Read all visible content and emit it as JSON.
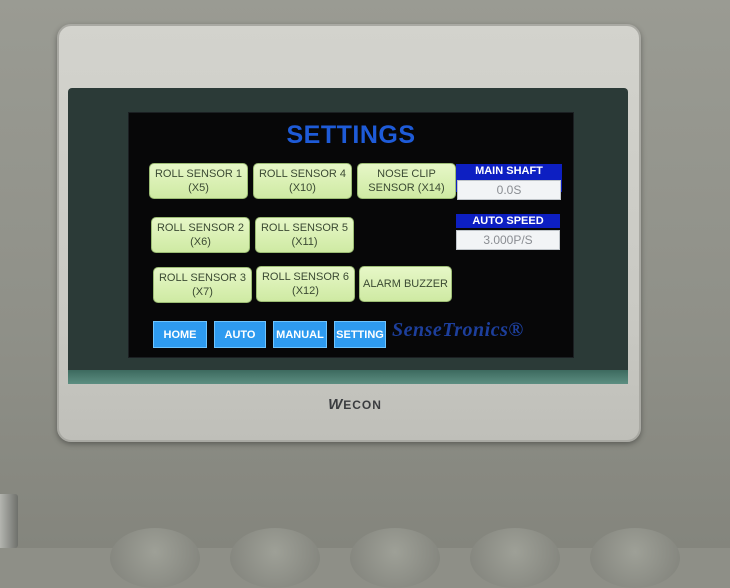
{
  "hmi": {
    "title": "SETTINGS",
    "sensor_buttons": [
      {
        "label": "ROLL SENSOR 1\n(X5)"
      },
      {
        "label": "ROLL SENSOR 4\n(X10)"
      },
      {
        "label": "NOSE CLIP\nSENSOR (X14)"
      },
      {
        "label": "ROLL SENSOR 2\n(X6)"
      },
      {
        "label": "ROLL SENSOR 5\n(X11)"
      },
      {
        "label": "ROLL SENSOR 3\n(X7)"
      },
      {
        "label": "ROLL SENSOR 6\n(X12)"
      },
      {
        "label": "ALARM BUZZER"
      }
    ],
    "main_shaft_delay": {
      "label": "MAIN SHAFT DELAY",
      "value": "0.0S"
    },
    "auto_speed": {
      "label": "AUTO SPEED",
      "value": "3.000P/S"
    },
    "nav": {
      "home": "HOME",
      "auto": "AUTO",
      "manual": "MANUAL",
      "setting": "SETTING"
    },
    "brand": "SenseTronics®"
  },
  "device_logo": {
    "mark": "W",
    "name": "ECON"
  },
  "colors": {
    "title_blue": "#1e5bd8",
    "button_green": "#d8efb0",
    "param_label_blue": "#0d1fc2",
    "nav_blue": "#2e9bf0"
  }
}
